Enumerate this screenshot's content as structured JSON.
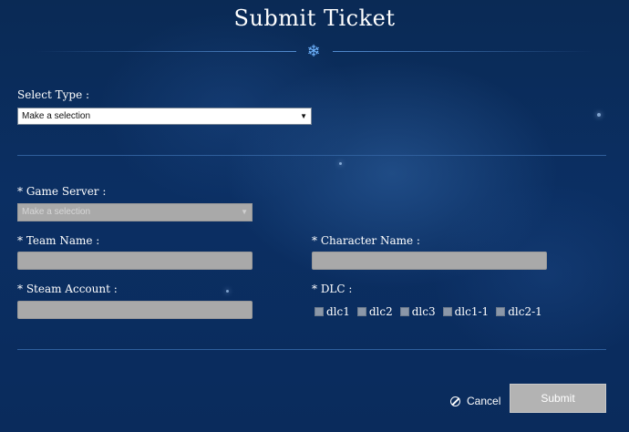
{
  "page": {
    "title": "Submit Ticket"
  },
  "form": {
    "select_type": {
      "label": "Select Type :",
      "selected": "Make a selection"
    },
    "game_server": {
      "label": "* Game Server :",
      "selected": "Make a selection",
      "disabled": true
    },
    "team_name": {
      "label": "* Team Name :",
      "value": ""
    },
    "character_name": {
      "label": "* Character Name :",
      "value": ""
    },
    "steam_account": {
      "label": "* Steam Account :",
      "value": ""
    },
    "dlc": {
      "label": "* DLC :",
      "options": [
        {
          "label": "dlc1",
          "checked": false
        },
        {
          "label": "dlc2",
          "checked": false
        },
        {
          "label": "dlc3",
          "checked": false
        },
        {
          "label": "dlc1-1",
          "checked": false
        },
        {
          "label": "dlc2-1",
          "checked": false
        }
      ]
    }
  },
  "actions": {
    "cancel_label": "Cancel",
    "cancel_icon": "ban-icon",
    "submit_label": "Submit"
  },
  "colors": {
    "background": "#0b2f63",
    "accent": "#6fb4ff",
    "input_disabled": "#a9a9a9",
    "submit_button": "#b3b3b3"
  }
}
